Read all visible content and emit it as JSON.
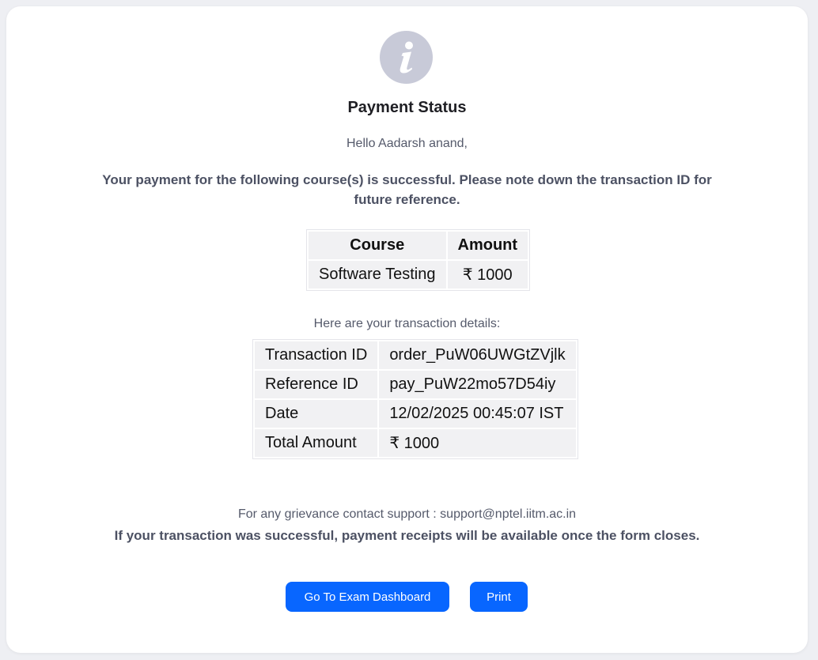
{
  "status": {
    "icon": "info-icon",
    "title": "Payment Status",
    "greeting": "Hello Aadarsh anand,",
    "message": "Your payment for the following course(s) is successful. Please note down the transaction ID for future reference."
  },
  "courses": {
    "headers": [
      "Course",
      "Amount"
    ],
    "rows": [
      [
        "Software Testing",
        "₹ 1000"
      ]
    ]
  },
  "transaction": {
    "label": "Here are your transaction details:",
    "rows": [
      [
        "Transaction ID",
        "order_PuW06UWGtZVjlk"
      ],
      [
        "Reference ID",
        "pay_PuW22mo57D54iy"
      ],
      [
        "Date",
        "12/02/2025 00:45:07 IST"
      ],
      [
        "Total Amount",
        "₹ 1000"
      ]
    ]
  },
  "footer": {
    "support": "For any grievance contact support : support@nptel.iitm.ac.in",
    "receipt_note": "If your transaction was successful, payment receipts will be available once the form closes."
  },
  "actions": {
    "dashboard_label": "Go To Exam Dashboard",
    "print_label": "Print"
  },
  "colors": {
    "primary": "#0866ff",
    "icon_bg": "#c8cad8",
    "page_bg": "#eeeff3"
  }
}
